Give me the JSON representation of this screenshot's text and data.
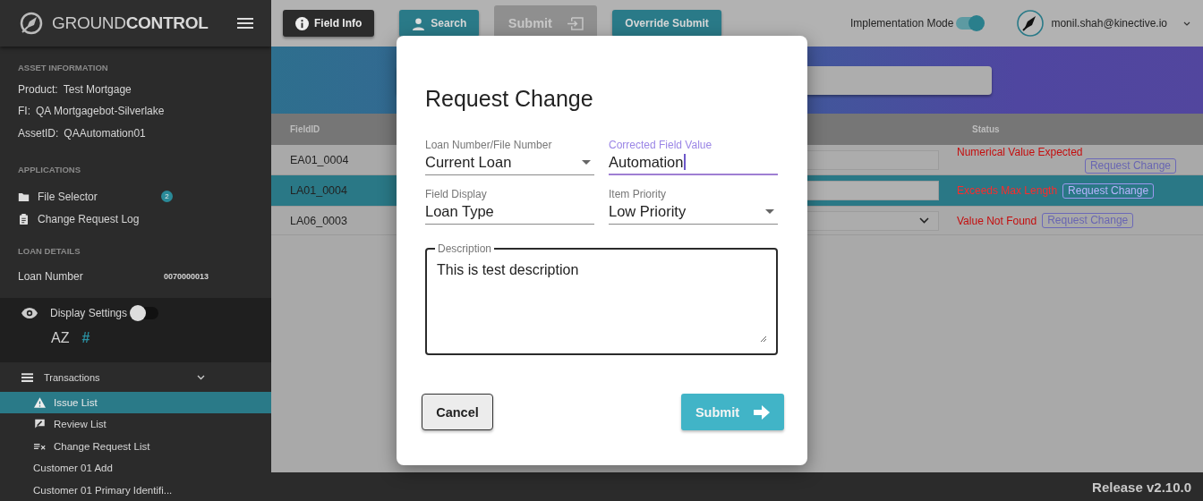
{
  "sidebar": {
    "brand": {
      "light": "GROUND",
      "bold": "CONTROL"
    },
    "asset_information": {
      "heading": "ASSET INFORMATION",
      "rows": [
        {
          "label": "Product:",
          "value": "Test Mortgage"
        },
        {
          "label": "FI:",
          "value": "QA Mortgagebot-Silverlake"
        },
        {
          "label": "AssetID:",
          "value": "QAAutomation01"
        }
      ]
    },
    "applications": {
      "heading": "APPLICATIONS",
      "items": [
        {
          "kind": "folder",
          "label": "File Selector",
          "badge": "2"
        },
        {
          "kind": "clipboard",
          "label": "Change Request Log"
        }
      ]
    },
    "loan_details": {
      "heading": "LOAN DETAILS",
      "rows": [
        {
          "label": "Loan Number",
          "value": "0070000013"
        }
      ]
    },
    "display_settings": {
      "label": "Display Settings",
      "on": false,
      "sort_options": [
        {
          "label": "AZ",
          "selected": false
        },
        {
          "label": "#",
          "selected": true
        }
      ]
    },
    "transactions": {
      "label": "Transactions",
      "expanded": true,
      "items": [
        {
          "kind": "warning",
          "label": "Issue List",
          "selected": true
        },
        {
          "kind": "review",
          "label": "Review List",
          "selected": false
        },
        {
          "kind": "checklist",
          "label": "Change Request List",
          "selected": false
        },
        {
          "kind": "plain",
          "label": "Customer 01 Add",
          "selected": false
        },
        {
          "kind": "plain",
          "label": "Customer 01 Primary Identifi...",
          "selected": false
        }
      ]
    }
  },
  "toolbar": {
    "buttons": [
      {
        "kind": "info",
        "label": "Field Info",
        "disabled": false
      },
      {
        "kind": "search",
        "label": "Search",
        "disabled": false
      },
      {
        "kind": "submit",
        "label": "Submit",
        "disabled": true
      },
      {
        "kind": "override",
        "label": "Override Submit",
        "disabled": false
      }
    ],
    "implementation_mode": {
      "label": "Implementation Mode",
      "on": true
    },
    "user": {
      "email": "monil.shah@kinective.io"
    }
  },
  "table": {
    "columns": [
      "FieldID",
      "Status"
    ],
    "rows": [
      {
        "field_id": "EA01_0004",
        "kind": "text",
        "status": "Numerical Value Expected",
        "action": "Request Change",
        "selected": false
      },
      {
        "field_id": "LA01_0004",
        "kind": "text",
        "status": "Exceeds Max Length",
        "action": "Request Change",
        "selected": true
      },
      {
        "field_id": "LA06_0003",
        "kind": "select",
        "status": "Value Not Found",
        "action": "Request Change",
        "selected": false
      }
    ]
  },
  "dialog": {
    "title": "Request Change",
    "fields": [
      {
        "kind": "select",
        "label": "Loan Number/File Number",
        "value": "Current Loan",
        "focused": false
      },
      {
        "kind": "text",
        "label": "Corrected Field Value",
        "value": "Automation",
        "focused": true
      },
      {
        "kind": "text",
        "label": "Field Display",
        "value": "Loan Type",
        "focused": false
      },
      {
        "kind": "select",
        "label": "Item Priority",
        "value": "Low Priority",
        "focused": false
      }
    ],
    "description": {
      "label": "Description",
      "value": "This is test description"
    },
    "buttons": [
      {
        "kind": "cancel",
        "label": "Cancel"
      },
      {
        "kind": "submit",
        "label": "Submit"
      }
    ]
  },
  "footer": {
    "release": "Release v2.10.0"
  }
}
